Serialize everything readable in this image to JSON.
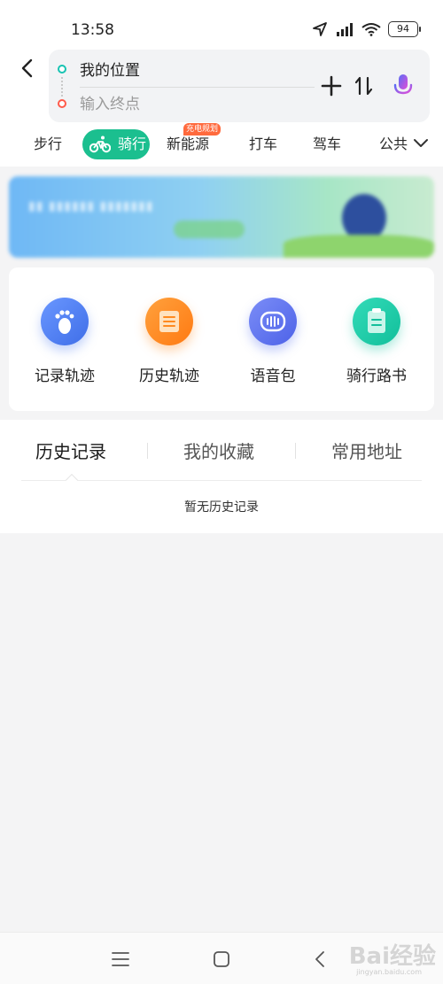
{
  "status_bar": {
    "time": "13:58",
    "battery": "94",
    "icons": [
      "location-arrow-icon",
      "signal-icon",
      "wifi-icon",
      "battery-icon"
    ]
  },
  "route": {
    "origin": "我的位置",
    "destination_placeholder": "输入终点",
    "destination_value": ""
  },
  "mode_tabs": {
    "items": [
      {
        "label": "步行"
      },
      {
        "label": "骑行"
      },
      {
        "label": "新能源"
      },
      {
        "label": "打车"
      },
      {
        "label": "驾车"
      },
      {
        "label": "公共"
      }
    ],
    "selected": "骑行",
    "badge": "充电规划"
  },
  "tools": {
    "items": [
      {
        "label": "记录轨迹",
        "icon": "footprint-icon",
        "color": "#4f7df2"
      },
      {
        "label": "历史轨迹",
        "icon": "document-icon",
        "color": "#ff8a1f"
      },
      {
        "label": "语音包",
        "icon": "voice-wave-icon",
        "color": "#5a72f0"
      },
      {
        "label": "骑行路书",
        "icon": "clipboard-icon",
        "color": "#1dc7a4"
      }
    ]
  },
  "history": {
    "tabs": [
      {
        "label": "历史记录"
      },
      {
        "label": "我的收藏"
      },
      {
        "label": "常用地址"
      }
    ],
    "selected": "历史记录",
    "empty_text": "暂无历史记录"
  },
  "watermark": {
    "logo": "Bai经验",
    "url": "jingyan.baidu.com"
  },
  "colors": {
    "accent": "#1bbf8f",
    "start_dot": "#17c3b2",
    "end_dot": "#ff5a4a",
    "badge": "#ff6a3d"
  }
}
